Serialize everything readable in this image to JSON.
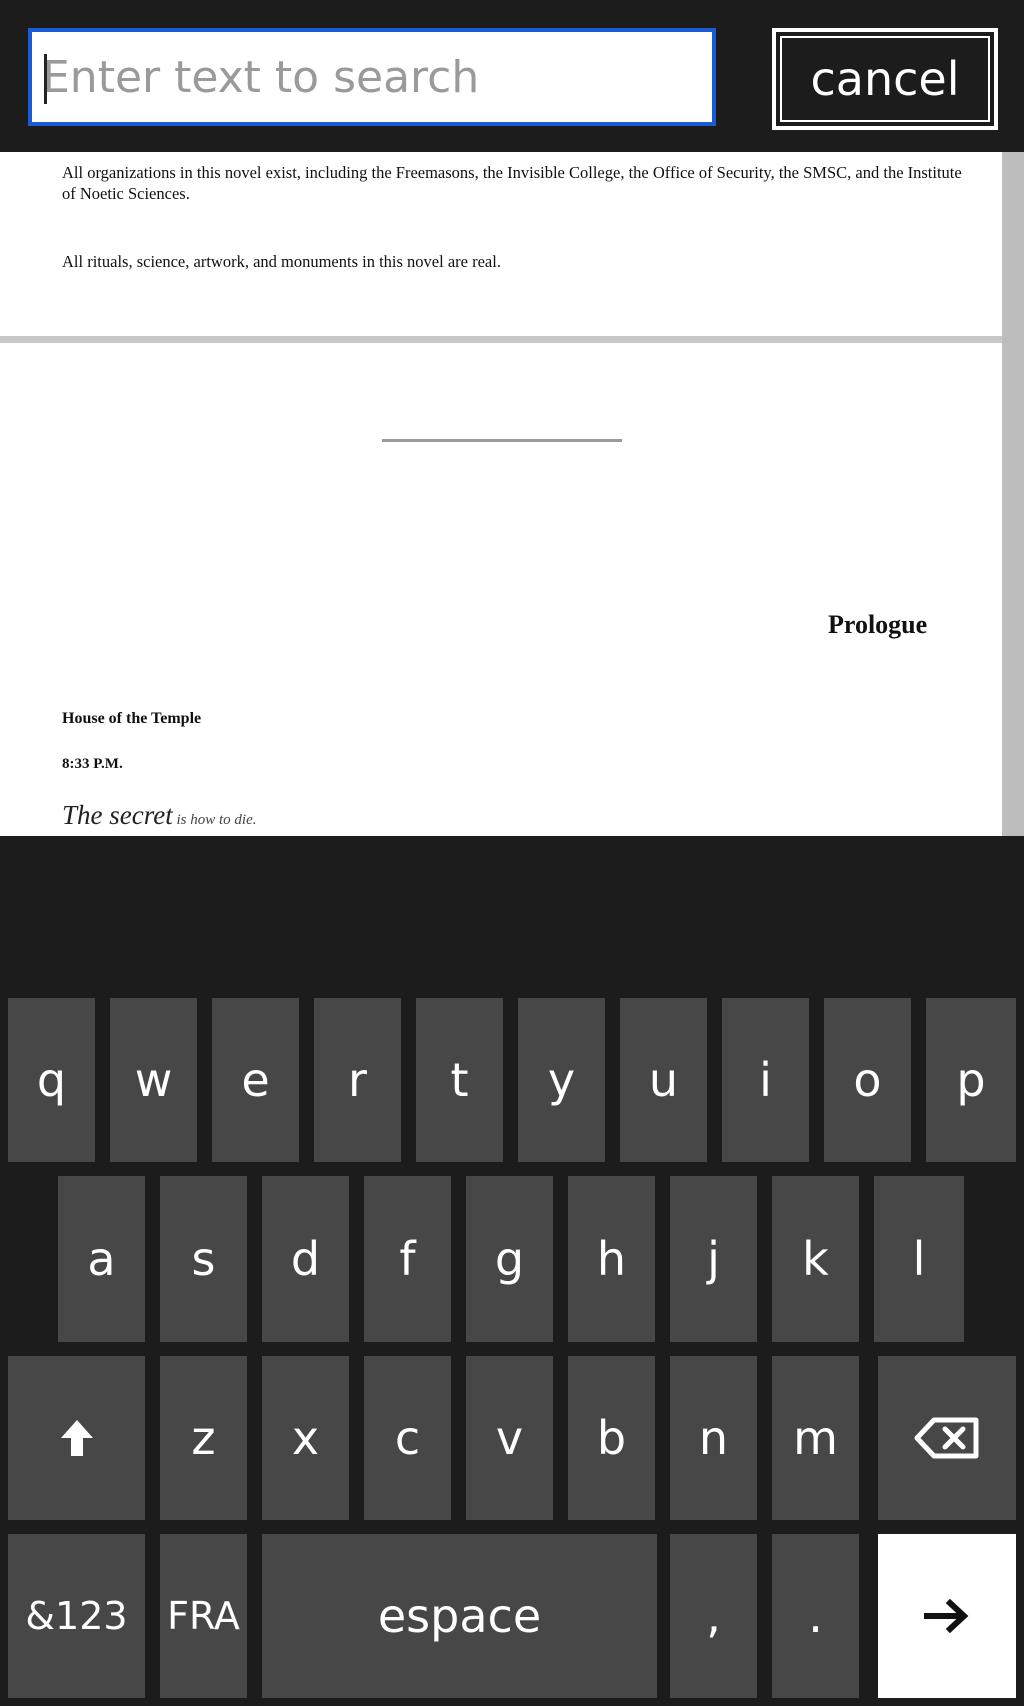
{
  "search": {
    "placeholder": "Enter text to search",
    "cancel_label": "cancel"
  },
  "document": {
    "paragraphs": [
      "All organizations in this novel exist, including the Freemasons, the Invisible College, the Office of Security, the SMSC, and the Institute of Noetic Sciences.",
      "All rituals, science, artwork, and monuments in this novel are real."
    ],
    "chapter_title": "Prologue",
    "location": "House of the Temple",
    "time": "8:33 P.M.",
    "opening_line_lead": "The secret",
    "opening_line_rest": " is how to die."
  },
  "keyboard": {
    "row1": [
      "q",
      "w",
      "e",
      "r",
      "t",
      "y",
      "u",
      "i",
      "o",
      "p"
    ],
    "row2": [
      "a",
      "s",
      "d",
      "f",
      "g",
      "h",
      "j",
      "k",
      "l"
    ],
    "row3": [
      "z",
      "x",
      "c",
      "v",
      "b",
      "n",
      "m"
    ],
    "symbols_label": "&123",
    "language_label": "FRA",
    "space_label": "espace",
    "comma_label": ",",
    "period_label": "."
  }
}
